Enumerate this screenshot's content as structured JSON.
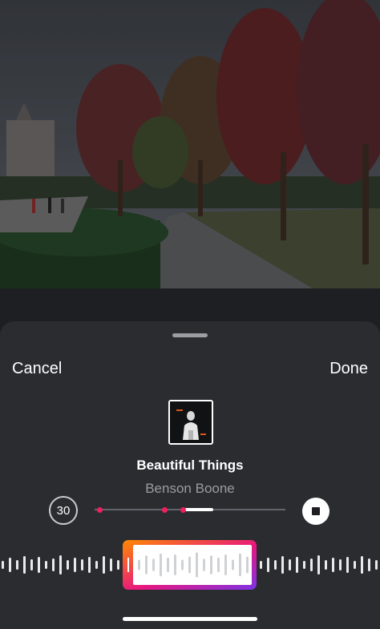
{
  "header": {
    "cancel_label": "Cancel",
    "done_label": "Done"
  },
  "track": {
    "title": "Beautiful Things",
    "artist": "Benson Boone",
    "duration_label": "30",
    "selection_start_fraction": 0.46,
    "selection_end_fraction": 0.62
  },
  "icons": {
    "stop": "stop-icon",
    "grabber": "sheet-grabber"
  },
  "colors": {
    "accent": "#f0205e",
    "selector_gradient_start": "#ff8a00",
    "selector_gradient_mid": "#e8177f",
    "selector_gradient_end": "#7b34e8"
  }
}
